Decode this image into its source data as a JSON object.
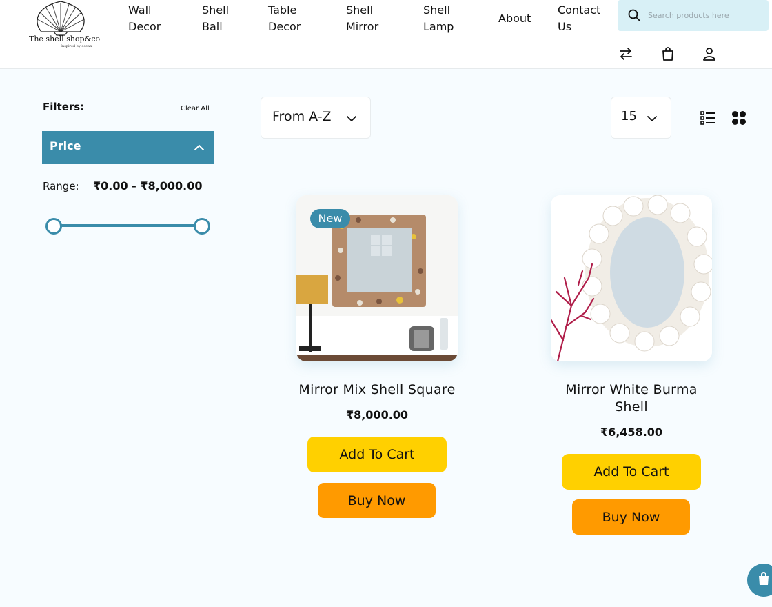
{
  "brand": {
    "name": "The shell shop&co",
    "tagline": "Inspired by ocean"
  },
  "nav": [
    {
      "line1": "Wall",
      "line2": "Decor"
    },
    {
      "line1": "Shell",
      "line2": "Ball"
    },
    {
      "line1": "Table",
      "line2": "Decor"
    },
    {
      "line1": "Shell",
      "line2": "Mirror"
    },
    {
      "line1": "Shell",
      "line2": "Lamp"
    },
    {
      "line1": "About",
      "line2": ""
    },
    {
      "line1": "Contact",
      "line2": "Us"
    }
  ],
  "search": {
    "placeholder": "Search products here",
    "value": ""
  },
  "header_icons": [
    "compare-arrows-icon",
    "shopping-bag-icon",
    "user-icon"
  ],
  "filters": {
    "title": "Filters:",
    "clear_all": "Clear All",
    "price_section": "Price",
    "range_label": "Range:",
    "range_value": "₹0.00 - ₹8,000.00"
  },
  "toolbar": {
    "sort": "From A-Z",
    "per_page": "15"
  },
  "products": [
    {
      "badge": "New",
      "name_line1": "Mirror Mix Shell Square",
      "name_line2": "",
      "price": "₹8,000.00",
      "add_to_cart": "Add To Cart",
      "buy_now": "Buy Now"
    },
    {
      "badge": "",
      "name_line1": "Mirror White Burma",
      "name_line2": "Shell",
      "price": "₹6,458.00",
      "add_to_cart": "Add To Cart",
      "buy_now": "Buy Now"
    }
  ],
  "colors": {
    "primary": "#3a8caa",
    "add_to_cart": "#ffd000",
    "buy_now": "#ff9a00",
    "search_bg": "#d8f0f6",
    "page_bg": "#f7fcff"
  }
}
